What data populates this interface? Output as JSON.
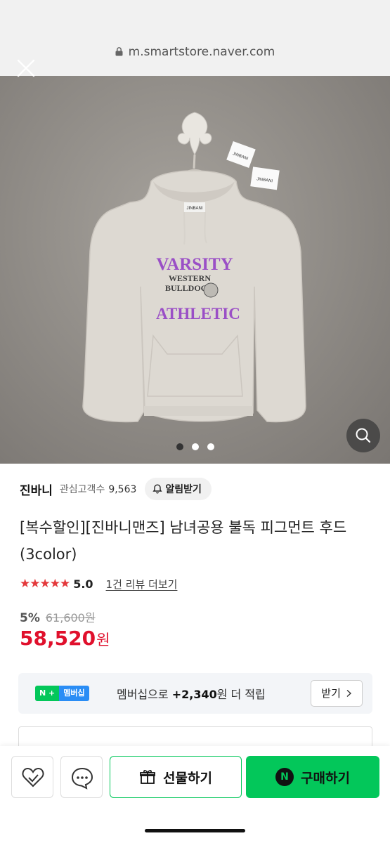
{
  "browser": {
    "url": "m.smartstore.naver.com",
    "close_icon": "close-icon",
    "lock_icon": "lock-icon"
  },
  "gallery": {
    "hoodie_print": {
      "line1": "VARSITY",
      "line2": "WESTERN",
      "line3": "BULLDOG",
      "line4": "ATHLETIC"
    },
    "tags": [
      "JINBANI",
      "JINBANI"
    ],
    "neck_label": "JINBANI",
    "dots_total": 3,
    "dots_active": 1,
    "zoom_icon": "search-icon"
  },
  "store": {
    "name": "진바니",
    "followers_label": "관심고객수",
    "followers_count": "9,563",
    "alert_label": "알림받기"
  },
  "product": {
    "title": "[복수할인][진바니맨즈] 남녀공용 불독 피그먼트 후드 (3color)",
    "rating_stars": "★★★★★",
    "rating": "5.0",
    "review_link": "1건 리뷰 더보기",
    "discount_rate": "5%",
    "original_price": "61,600원",
    "sale_price": "58,520",
    "price_unit": "원"
  },
  "membership": {
    "badge_n": "N +",
    "badge_label": "멤버십",
    "text_prefix": "멤버십으로",
    "points": "+2,340",
    "text_suffix": "원 더 적립",
    "receive_label": "받기"
  },
  "bottom_bar": {
    "gift_label": "선물하기",
    "buy_label": "구매하기",
    "npay_letter": "N"
  },
  "colors": {
    "price_red": "#e0102c",
    "naver_green": "#03c75a",
    "star_red": "#e4393c"
  }
}
